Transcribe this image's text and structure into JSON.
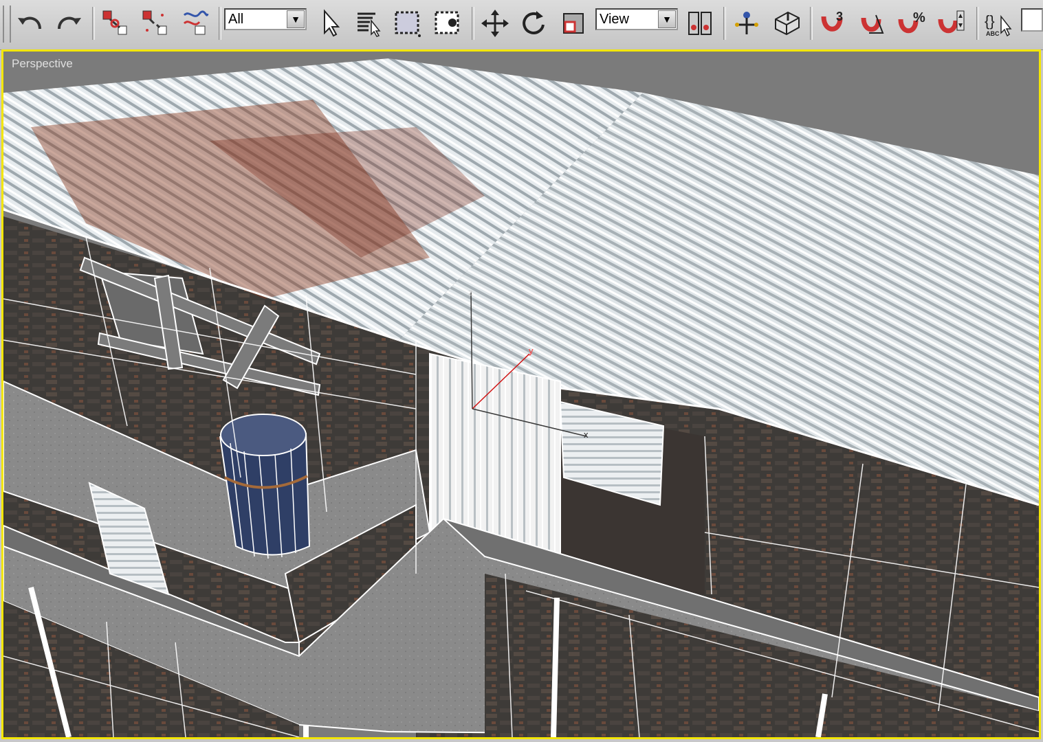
{
  "app": {
    "toolbar": {
      "undo_icon": "undo-icon",
      "redo_icon": "redo-icon",
      "selection_filter": "All",
      "ref_coord_system": "View"
    },
    "viewport": {
      "label": "Perspective",
      "active_border_color": "#f3e600",
      "gizmo_axes": [
        "z",
        "y",
        "x"
      ]
    }
  }
}
